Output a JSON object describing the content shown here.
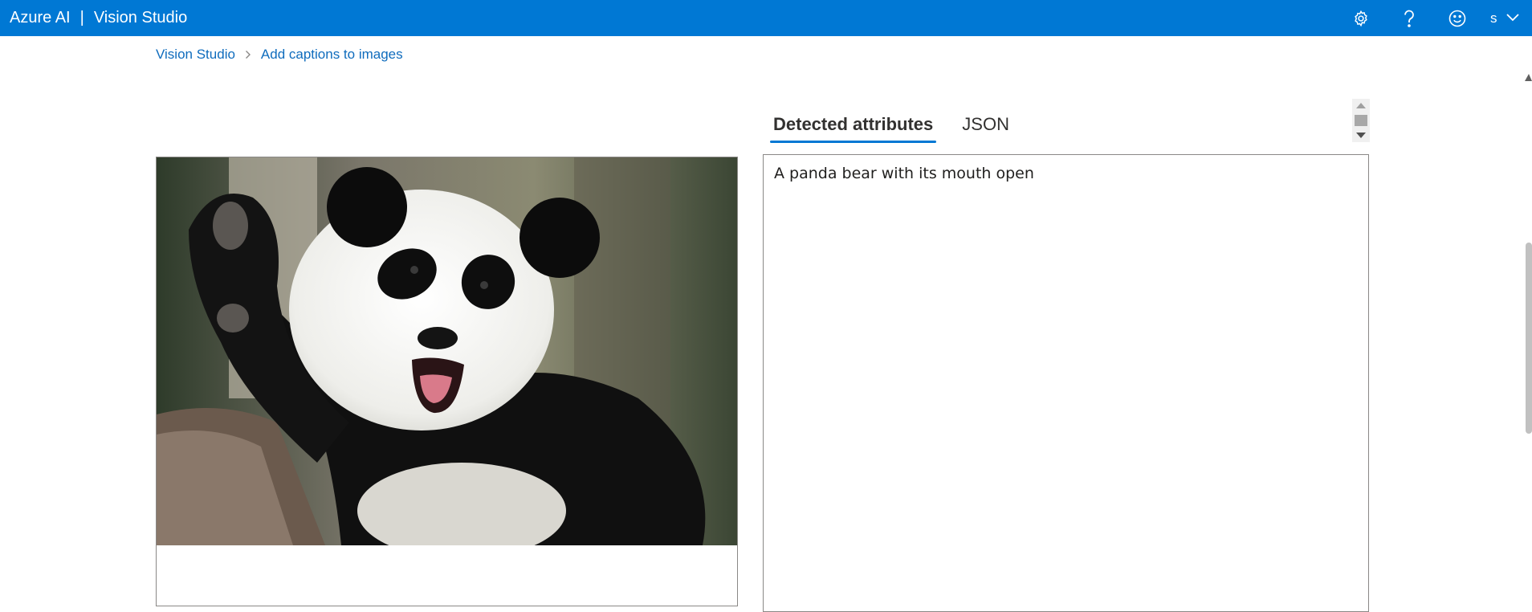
{
  "header": {
    "brand": "Azure AI",
    "separator": "|",
    "product": "Vision Studio",
    "account_initial": "s",
    "icons": [
      "settings-icon",
      "help-icon",
      "feedback-smiley-icon",
      "chevron-down-icon"
    ]
  },
  "breadcrumb": {
    "home": "Vision Studio",
    "current": "Add captions to images"
  },
  "image_panel": {
    "alt": "Panda bear sample image"
  },
  "tabs": [
    {
      "label": "Detected attributes",
      "active": true
    },
    {
      "label": "JSON",
      "active": false
    }
  ],
  "results": {
    "caption": "A panda bear with its mouth open"
  },
  "colors": {
    "header_bg": "#0078d4",
    "link": "#0f6cbd",
    "tab_underline": "#0078d4"
  }
}
